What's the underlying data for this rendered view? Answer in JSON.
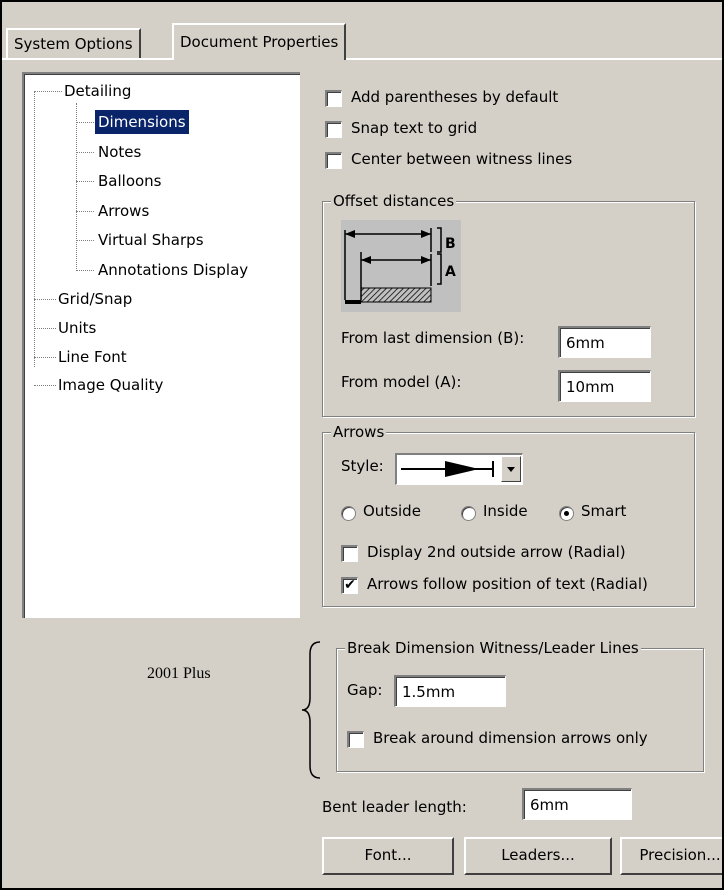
{
  "tabs": [
    {
      "label": "System Options",
      "active": false
    },
    {
      "label": "Document Properties",
      "active": true
    }
  ],
  "tree": {
    "items": [
      {
        "label": "Detailing",
        "selected": false
      },
      {
        "label": "Dimensions",
        "selected": true
      },
      {
        "label": "Notes",
        "selected": false
      },
      {
        "label": "Balloons",
        "selected": false
      },
      {
        "label": "Arrows",
        "selected": false
      },
      {
        "label": "Virtual Sharps",
        "selected": false
      },
      {
        "label": "Annotations Display",
        "selected": false
      },
      {
        "label": "Grid/Snap",
        "selected": false
      },
      {
        "label": "Units",
        "selected": false
      },
      {
        "label": "Line Font",
        "selected": false
      },
      {
        "label": "Image Quality",
        "selected": false
      }
    ]
  },
  "options": {
    "add_parentheses": {
      "label": "Add parentheses by default",
      "checked": false
    },
    "snap_text": {
      "label": "Snap text to grid",
      "checked": false
    },
    "center_witness": {
      "label": "Center between witness lines",
      "checked": false
    }
  },
  "offset": {
    "title": "Offset distances",
    "diagram_b": "B",
    "diagram_a": "A",
    "from_last_label": "From last dimension (B):",
    "from_last_value": "6mm",
    "from_model_label": "From model (A):",
    "from_model_value": "10mm"
  },
  "arrows": {
    "title": "Arrows",
    "style_label": "Style:",
    "radio_outside": "Outside",
    "radio_inside": "Inside",
    "radio_smart": "Smart",
    "selected": "Smart",
    "display_2nd": {
      "label": "Display 2nd outside arrow (Radial)",
      "checked": false
    },
    "follow_text": {
      "label": "Arrows follow position of text (Radial)",
      "checked": true
    }
  },
  "break_lines": {
    "title": "Break Dimension Witness/Leader Lines",
    "gap_label": "Gap:",
    "gap_value": "1.5mm",
    "break_around": {
      "label": "Break around dimension arrows only",
      "checked": false
    }
  },
  "annotation_note": "2001 Plus",
  "bent_leader": {
    "label": "Bent leader length:",
    "value": "6mm"
  },
  "buttons": {
    "font": "Font...",
    "leaders": "Leaders...",
    "precision": "Precision..."
  }
}
